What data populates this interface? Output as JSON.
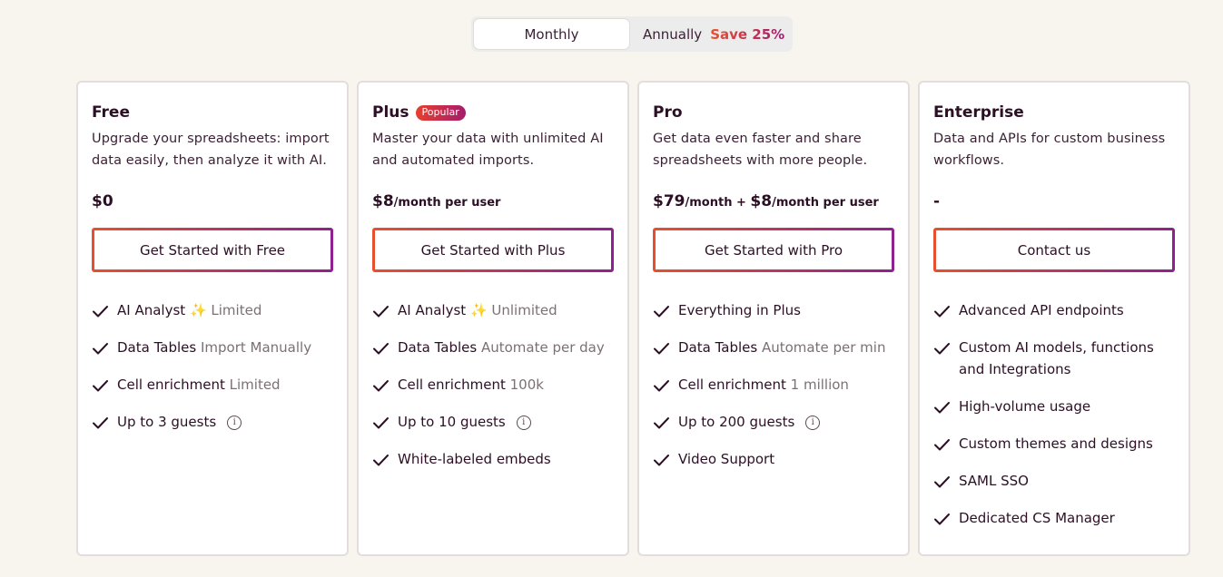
{
  "billing_toggle": {
    "monthly_label": "Monthly",
    "annually_label": "Annually",
    "save_label": "Save 25%"
  },
  "plans": [
    {
      "name": "Free",
      "badge": "",
      "description": "Upgrade your spreadsheets: import data easily, then analyze it with AI.",
      "price_main": "$0",
      "price_unit": "",
      "price_plus": "",
      "price_main2": "",
      "price_unit2": "",
      "cta_label": "Get Started with Free",
      "features": [
        {
          "label": "AI Analyst",
          "sparkle": "✨",
          "detail": "Limited",
          "info": false
        },
        {
          "label": "Data Tables",
          "sparkle": "",
          "detail": "Import Manually",
          "info": false
        },
        {
          "label": "Cell enrichment",
          "sparkle": "",
          "detail": "Limited",
          "info": false
        },
        {
          "label": "Up to 3 guests",
          "sparkle": "",
          "detail": "",
          "info": true
        }
      ]
    },
    {
      "name": "Plus",
      "badge": "Popular",
      "description": "Master your data with unlimited AI and automated imports.",
      "price_main": "$8",
      "price_unit": "/month per user",
      "price_plus": "",
      "price_main2": "",
      "price_unit2": "",
      "cta_label": "Get Started with Plus",
      "features": [
        {
          "label": "AI Analyst",
          "sparkle": "✨",
          "detail": "Unlimited",
          "info": false
        },
        {
          "label": "Data Tables",
          "sparkle": "",
          "detail": "Automate per day",
          "info": false
        },
        {
          "label": "Cell enrichment",
          "sparkle": "",
          "detail": "100k",
          "info": false
        },
        {
          "label": "Up to 10 guests",
          "sparkle": "",
          "detail": "",
          "info": true
        },
        {
          "label": "White-labeled embeds",
          "sparkle": "",
          "detail": "",
          "info": false
        }
      ]
    },
    {
      "name": "Pro",
      "badge": "",
      "description": "Get data even faster and share spreadsheets with more people.",
      "price_main": "$79",
      "price_unit": "/month",
      "price_plus": " + ",
      "price_main2": "$8",
      "price_unit2": "/month per user",
      "cta_label": "Get Started with Pro",
      "features": [
        {
          "label": "Everything in Plus",
          "sparkle": "",
          "detail": "",
          "info": false
        },
        {
          "label": "Data Tables",
          "sparkle": "",
          "detail": "Automate per min",
          "info": false
        },
        {
          "label": "Cell enrichment",
          "sparkle": "",
          "detail": "1 million",
          "info": false
        },
        {
          "label": "Up to 200 guests",
          "sparkle": "",
          "detail": "",
          "info": true
        },
        {
          "label": "Video Support",
          "sparkle": "",
          "detail": "",
          "info": false
        }
      ]
    },
    {
      "name": "Enterprise",
      "badge": "",
      "description": "Data and APIs for custom business workflows.",
      "price_main": "-",
      "price_unit": "",
      "price_plus": "",
      "price_main2": "",
      "price_unit2": "",
      "cta_label": "Contact us",
      "features": [
        {
          "label": "Advanced API endpoints",
          "sparkle": "",
          "detail": "",
          "info": false
        },
        {
          "label": "Custom AI models, functions and Integrations",
          "sparkle": "",
          "detail": "",
          "info": false
        },
        {
          "label": "High-volume usage",
          "sparkle": "",
          "detail": "",
          "info": false
        },
        {
          "label": "Custom themes and designs",
          "sparkle": "",
          "detail": "",
          "info": false
        },
        {
          "label": "SAML SSO",
          "sparkle": "",
          "detail": "",
          "info": false
        },
        {
          "label": "Dedicated CS Manager",
          "sparkle": "",
          "detail": "",
          "info": false
        }
      ]
    }
  ],
  "info_glyph": "i",
  "colors": {
    "background": "#f8f5ef",
    "text": "#2c0f25",
    "accent_start": "#e8502c",
    "accent_end": "#8f2090",
    "muted": "#7b7075"
  }
}
